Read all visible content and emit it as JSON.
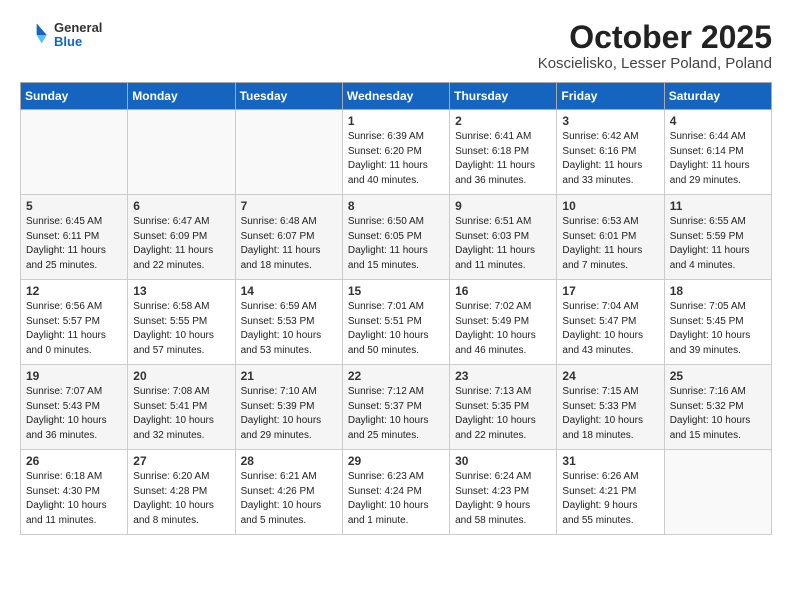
{
  "logo": {
    "general": "General",
    "blue": "Blue"
  },
  "header": {
    "month": "October 2025",
    "location": "Koscielisko, Lesser Poland, Poland"
  },
  "weekdays": [
    "Sunday",
    "Monday",
    "Tuesday",
    "Wednesday",
    "Thursday",
    "Friday",
    "Saturday"
  ],
  "weeks": [
    [
      {
        "day": "",
        "info": ""
      },
      {
        "day": "",
        "info": ""
      },
      {
        "day": "",
        "info": ""
      },
      {
        "day": "1",
        "info": "Sunrise: 6:39 AM\nSunset: 6:20 PM\nDaylight: 11 hours\nand 40 minutes."
      },
      {
        "day": "2",
        "info": "Sunrise: 6:41 AM\nSunset: 6:18 PM\nDaylight: 11 hours\nand 36 minutes."
      },
      {
        "day": "3",
        "info": "Sunrise: 6:42 AM\nSunset: 6:16 PM\nDaylight: 11 hours\nand 33 minutes."
      },
      {
        "day": "4",
        "info": "Sunrise: 6:44 AM\nSunset: 6:14 PM\nDaylight: 11 hours\nand 29 minutes."
      }
    ],
    [
      {
        "day": "5",
        "info": "Sunrise: 6:45 AM\nSunset: 6:11 PM\nDaylight: 11 hours\nand 25 minutes."
      },
      {
        "day": "6",
        "info": "Sunrise: 6:47 AM\nSunset: 6:09 PM\nDaylight: 11 hours\nand 22 minutes."
      },
      {
        "day": "7",
        "info": "Sunrise: 6:48 AM\nSunset: 6:07 PM\nDaylight: 11 hours\nand 18 minutes."
      },
      {
        "day": "8",
        "info": "Sunrise: 6:50 AM\nSunset: 6:05 PM\nDaylight: 11 hours\nand 15 minutes."
      },
      {
        "day": "9",
        "info": "Sunrise: 6:51 AM\nSunset: 6:03 PM\nDaylight: 11 hours\nand 11 minutes."
      },
      {
        "day": "10",
        "info": "Sunrise: 6:53 AM\nSunset: 6:01 PM\nDaylight: 11 hours\nand 7 minutes."
      },
      {
        "day": "11",
        "info": "Sunrise: 6:55 AM\nSunset: 5:59 PM\nDaylight: 11 hours\nand 4 minutes."
      }
    ],
    [
      {
        "day": "12",
        "info": "Sunrise: 6:56 AM\nSunset: 5:57 PM\nDaylight: 11 hours\nand 0 minutes."
      },
      {
        "day": "13",
        "info": "Sunrise: 6:58 AM\nSunset: 5:55 PM\nDaylight: 10 hours\nand 57 minutes."
      },
      {
        "day": "14",
        "info": "Sunrise: 6:59 AM\nSunset: 5:53 PM\nDaylight: 10 hours\nand 53 minutes."
      },
      {
        "day": "15",
        "info": "Sunrise: 7:01 AM\nSunset: 5:51 PM\nDaylight: 10 hours\nand 50 minutes."
      },
      {
        "day": "16",
        "info": "Sunrise: 7:02 AM\nSunset: 5:49 PM\nDaylight: 10 hours\nand 46 minutes."
      },
      {
        "day": "17",
        "info": "Sunrise: 7:04 AM\nSunset: 5:47 PM\nDaylight: 10 hours\nand 43 minutes."
      },
      {
        "day": "18",
        "info": "Sunrise: 7:05 AM\nSunset: 5:45 PM\nDaylight: 10 hours\nand 39 minutes."
      }
    ],
    [
      {
        "day": "19",
        "info": "Sunrise: 7:07 AM\nSunset: 5:43 PM\nDaylight: 10 hours\nand 36 minutes."
      },
      {
        "day": "20",
        "info": "Sunrise: 7:08 AM\nSunset: 5:41 PM\nDaylight: 10 hours\nand 32 minutes."
      },
      {
        "day": "21",
        "info": "Sunrise: 7:10 AM\nSunset: 5:39 PM\nDaylight: 10 hours\nand 29 minutes."
      },
      {
        "day": "22",
        "info": "Sunrise: 7:12 AM\nSunset: 5:37 PM\nDaylight: 10 hours\nand 25 minutes."
      },
      {
        "day": "23",
        "info": "Sunrise: 7:13 AM\nSunset: 5:35 PM\nDaylight: 10 hours\nand 22 minutes."
      },
      {
        "day": "24",
        "info": "Sunrise: 7:15 AM\nSunset: 5:33 PM\nDaylight: 10 hours\nand 18 minutes."
      },
      {
        "day": "25",
        "info": "Sunrise: 7:16 AM\nSunset: 5:32 PM\nDaylight: 10 hours\nand 15 minutes."
      }
    ],
    [
      {
        "day": "26",
        "info": "Sunrise: 6:18 AM\nSunset: 4:30 PM\nDaylight: 10 hours\nand 11 minutes."
      },
      {
        "day": "27",
        "info": "Sunrise: 6:20 AM\nSunset: 4:28 PM\nDaylight: 10 hours\nand 8 minutes."
      },
      {
        "day": "28",
        "info": "Sunrise: 6:21 AM\nSunset: 4:26 PM\nDaylight: 10 hours\nand 5 minutes."
      },
      {
        "day": "29",
        "info": "Sunrise: 6:23 AM\nSunset: 4:24 PM\nDaylight: 10 hours\nand 1 minute."
      },
      {
        "day": "30",
        "info": "Sunrise: 6:24 AM\nSunset: 4:23 PM\nDaylight: 9 hours\nand 58 minutes."
      },
      {
        "day": "31",
        "info": "Sunrise: 6:26 AM\nSunset: 4:21 PM\nDaylight: 9 hours\nand 55 minutes."
      },
      {
        "day": "",
        "info": ""
      }
    ]
  ]
}
